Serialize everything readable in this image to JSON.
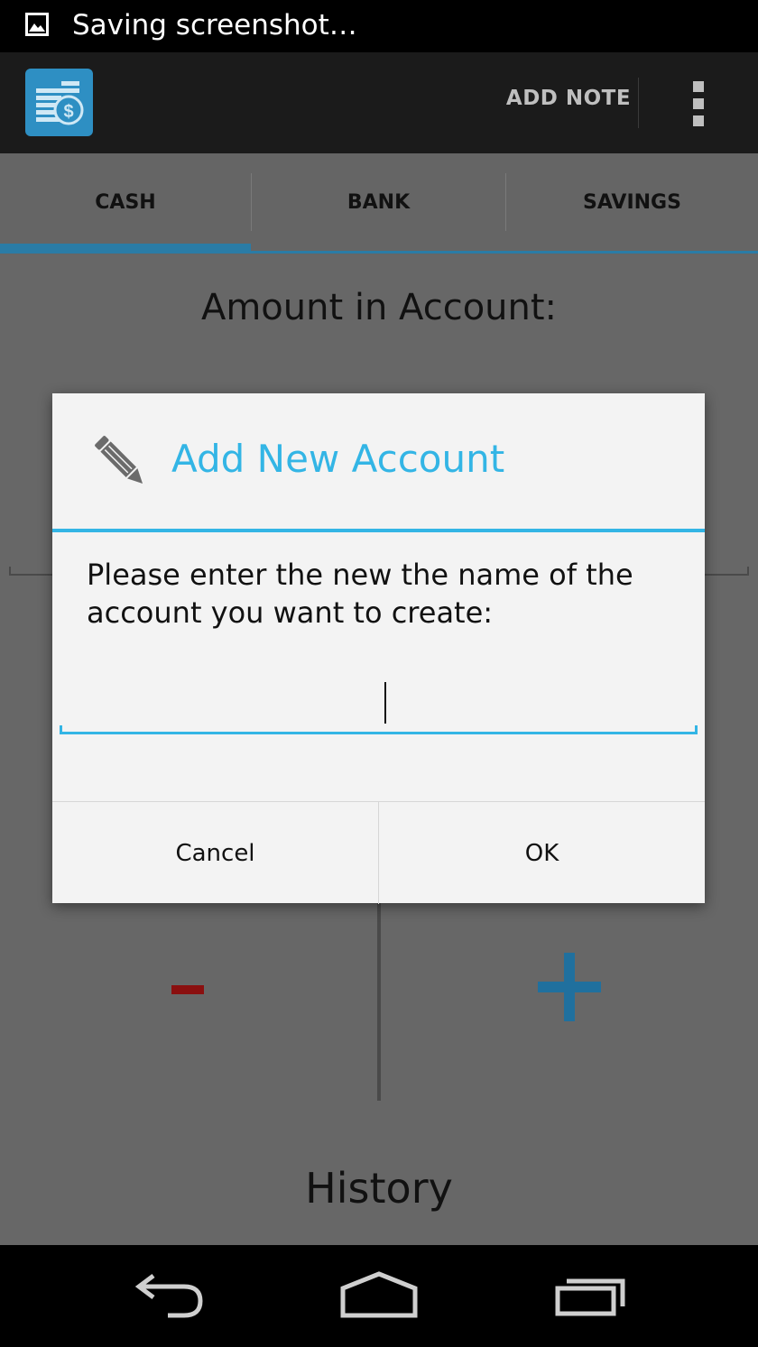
{
  "status_bar": {
    "text": "Saving screenshot…",
    "icon": "image-icon"
  },
  "action_bar": {
    "app_icon": "money-coins-icon",
    "add_note_label": "ADD NOTE",
    "overflow_icon": "overflow-menu-icon"
  },
  "tabs": [
    {
      "label": "CASH",
      "selected": true
    },
    {
      "label": "BANK",
      "selected": false
    },
    {
      "label": "SAVINGS",
      "selected": false
    }
  ],
  "main": {
    "amount_label": "Amount in Account:",
    "minus_label": "-",
    "plus_label": "+",
    "history_label": "History"
  },
  "dialog": {
    "icon": "pencil-icon",
    "title": "Add New Account",
    "message": "Please enter the new the name of the account you want to create:",
    "input_value": "",
    "cancel_label": "Cancel",
    "ok_label": "OK"
  },
  "nav_bar": {
    "back": "back-icon",
    "home": "home-icon",
    "recents": "recents-icon"
  },
  "colors": {
    "accent": "#33b5e5",
    "minus": "#8a0f0f",
    "plus": "#20709e",
    "tab_indicator": "#2a7ca6"
  }
}
